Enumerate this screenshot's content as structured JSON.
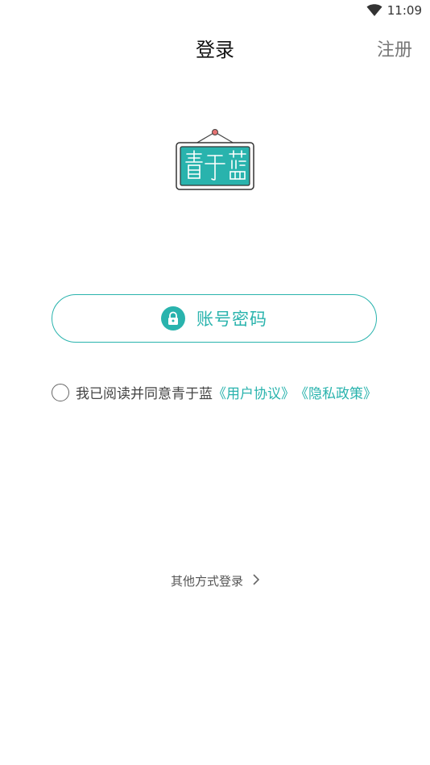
{
  "status": {
    "time": "11:09",
    "wifi_icon": "wifi-icon"
  },
  "header": {
    "title": "登录",
    "register_label": "注册"
  },
  "logo": {
    "text": "青于蓝",
    "color": "#29b3ad"
  },
  "login": {
    "button_label": "账号密码",
    "icon": "lock-icon"
  },
  "agreement": {
    "checked": false,
    "prefix": "我已阅读并同意青于蓝",
    "user_agreement": "《用户协议》",
    "privacy_policy": "《隐私政策》"
  },
  "other": {
    "label": "其他方式登录",
    "icon": "chevron-right-icon"
  },
  "colors": {
    "accent": "#29b3ad"
  }
}
